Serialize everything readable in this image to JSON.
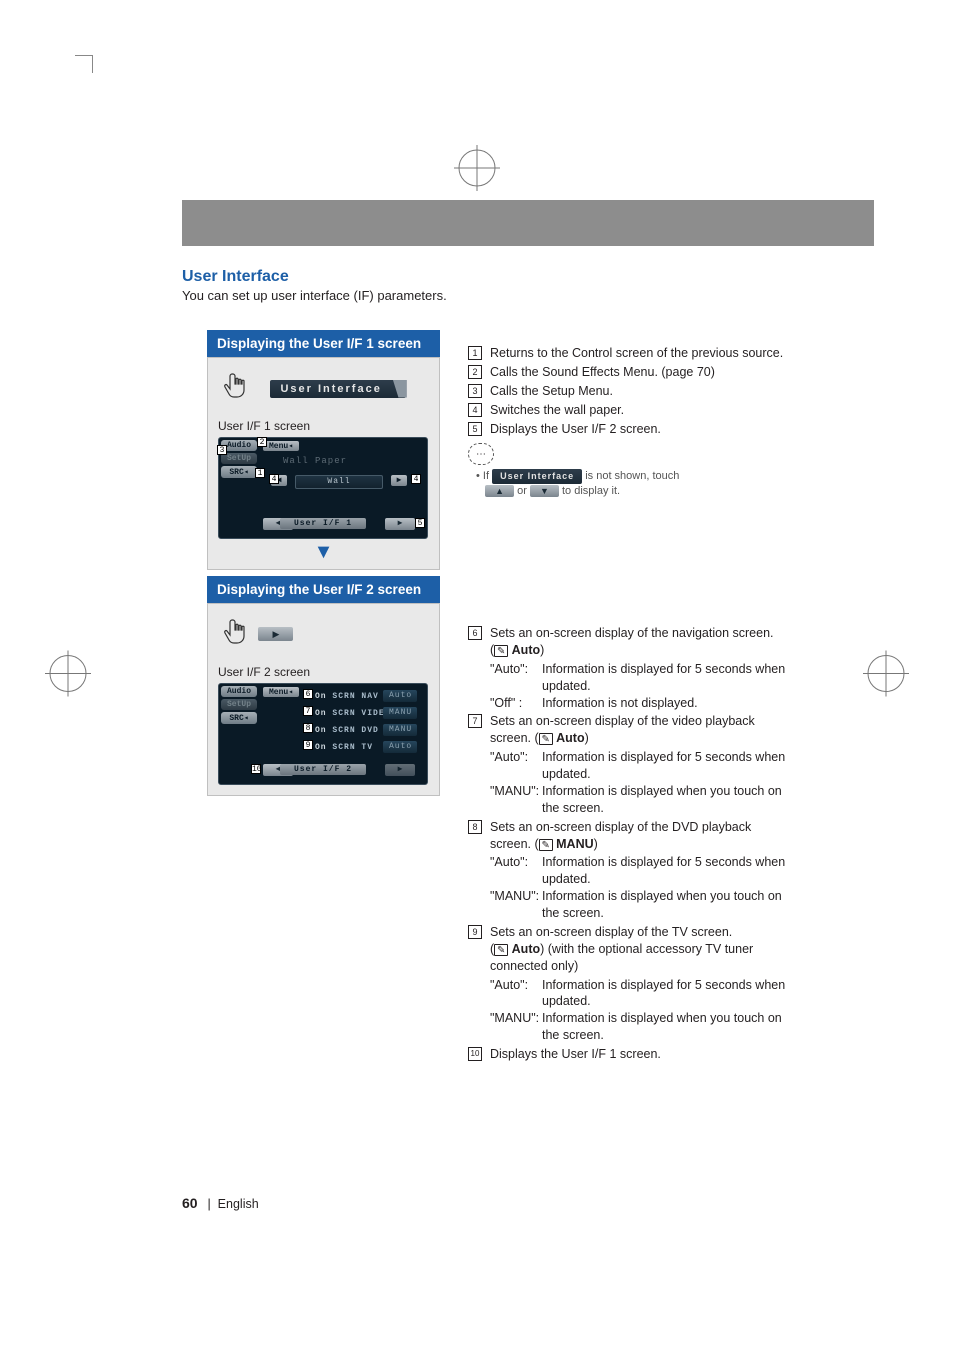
{
  "section": {
    "title": "User Interface",
    "intro": "You can set up user interface (IF) parameters."
  },
  "left": {
    "card1": {
      "heading": "Displaying the User I/F 1 screen",
      "title_band": "User Interface",
      "sub_label": "User I/F 1 screen",
      "tabs": {
        "audio": "Audio",
        "setup": "SetUp",
        "src": "SRC"
      },
      "menu": "Menu",
      "row_label": "Wall Paper",
      "row_value": "Wall",
      "pager_title": "User I/F 1"
    },
    "card2": {
      "heading": "Displaying the User I/F 2 screen",
      "sub_label": "User I/F 2 screen",
      "tabs": {
        "audio": "Audio",
        "setup": "SetUp",
        "src": "SRC"
      },
      "menu": "Menu",
      "rows": [
        {
          "n": "6",
          "label": "On SCRN NAV",
          "val": "Auto"
        },
        {
          "n": "7",
          "label": "On SCRN VIDEO",
          "val": "MANU"
        },
        {
          "n": "8",
          "label": "On SCRN DVD",
          "val": "MANU"
        },
        {
          "n": "9",
          "label": "On SCRN TV",
          "val": "Auto"
        }
      ],
      "pager_title": "User I/F 2"
    }
  },
  "right": {
    "list1": [
      {
        "n": "1",
        "t": "Returns to the Control screen of the previous source."
      },
      {
        "n": "2",
        "t": "Calls the Sound Effects Menu. (page 70)"
      },
      {
        "n": "3",
        "t": "Calls the Setup Menu."
      },
      {
        "n": "4",
        "t": "Switches the wall paper."
      },
      {
        "n": "5",
        "t": "Displays the User I/F 2 screen."
      }
    ],
    "note": {
      "prefix": "If",
      "pill": "User Interface",
      "mid": "is not shown, touch",
      "or": "or",
      "suffix": "to display it."
    },
    "list2": [
      {
        "n": "6",
        "lead": "Sets an on-screen display of the navigation screen.",
        "default": "Auto",
        "defs": [
          {
            "k": "\"Auto\":",
            "v": "Information is displayed for 5 seconds when updated."
          },
          {
            "k": "\"Off\" :",
            "v": "Information is not displayed."
          }
        ]
      },
      {
        "n": "7",
        "lead": "Sets an on-screen display of the video playback screen.",
        "default": "Auto",
        "defs": [
          {
            "k": "\"Auto\":",
            "v": "Information is displayed for 5 seconds when updated."
          },
          {
            "k": "\"MANU\":",
            "v": "Information is displayed when you touch on the screen."
          }
        ]
      },
      {
        "n": "8",
        "lead": "Sets an on-screen display of the DVD playback screen.",
        "default": "MANU",
        "defs": [
          {
            "k": "\"Auto\":",
            "v": "Information is displayed for 5 seconds when updated."
          },
          {
            "k": "\"MANU\":",
            "v": "Information is displayed when you touch on the screen."
          }
        ]
      },
      {
        "n": "9",
        "lead": "Sets an on-screen display of the TV screen.",
        "default": "Auto",
        "extra": "(with the optional accessory TV tuner connected only)",
        "defs": [
          {
            "k": "\"Auto\":",
            "v": "Information is displayed for 5 seconds when updated."
          },
          {
            "k": "\"MANU\":",
            "v": "Information is displayed when you touch on the screen."
          }
        ]
      },
      {
        "n": "10",
        "lead": "Displays the User I/F 1 screen."
      }
    ]
  },
  "footer": {
    "page": "60",
    "divider": "|",
    "lang": "English"
  }
}
